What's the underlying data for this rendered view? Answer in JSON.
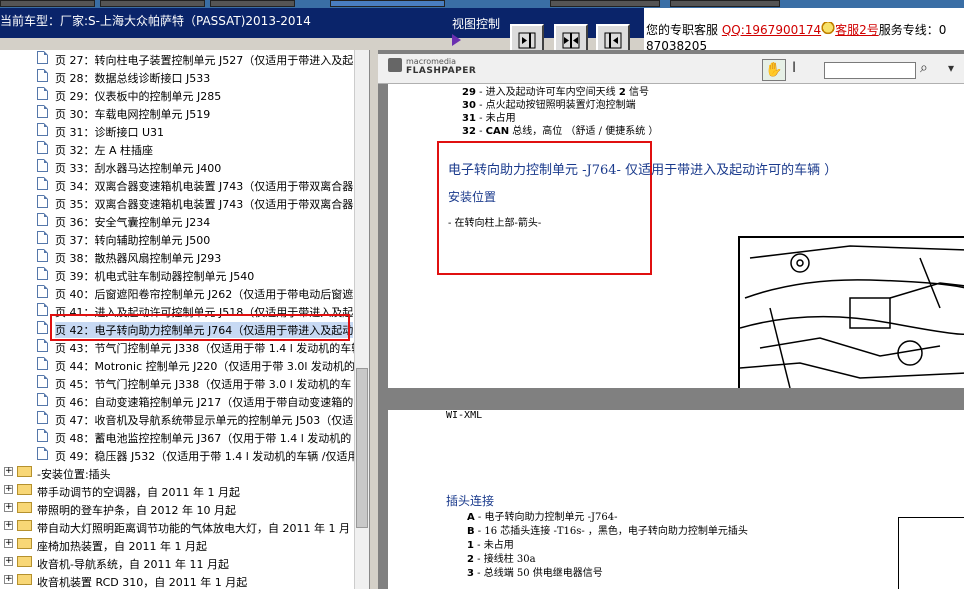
{
  "header": {
    "car_title": "当前车型：厂家:S-上海大众帕萨特（PASSAT)2013-2014",
    "view_control_label": "视图控制",
    "service_prefix": "您的专职客服",
    "qq": "QQ:1967900174",
    "kefu2": "客服2号",
    "hotline_label": "服务专线：0",
    "hotline_cont": "87038205"
  },
  "tree": {
    "pages": [
      {
        "text": "页 27：转向柱电子装置控制单元 J527（仅适用于带进入及起",
        "selected": false
      },
      {
        "text": "页 28：数据总线诊断接口 J533",
        "selected": false
      },
      {
        "text": "页 29：仪表板中的控制单元 J285",
        "selected": false
      },
      {
        "text": "页 30：车载电网控制单元 J519",
        "selected": false
      },
      {
        "text": "页 31：诊断接口 U31",
        "selected": false
      },
      {
        "text": "页 32：左 A 柱插座",
        "selected": false
      },
      {
        "text": "页 33：刮水器马达控制单元 J400",
        "selected": false
      },
      {
        "text": "页 34：双离合器变速箱机电装置 J743（仅适用于带双离合器",
        "selected": false
      },
      {
        "text": "页 35：双离合器变速箱机电装置 J743（仅适用于带双离合器",
        "selected": false
      },
      {
        "text": "页 36：安全气囊控制单元 J234",
        "selected": false
      },
      {
        "text": "页 37：转向辅助控制单元 J500",
        "selected": false
      },
      {
        "text": "页 38：散热器风扇控制单元 J293",
        "selected": false
      },
      {
        "text": "页 39：机电式驻车制动器控制单元 J540",
        "selected": false
      },
      {
        "text": "页 40：后窗遮阳卷帘控制单元 J262（仅适用于带电动后窗遮",
        "selected": false
      },
      {
        "text": "页 41：进入及起动许可控制单元 J518（仅适用于带进入及起",
        "selected": false
      },
      {
        "text": "页 42：电子转向助力控制单元 J764（仅适用于带进入及起动",
        "selected": true
      },
      {
        "text": "页 43：节气门控制单元 J338（仅适用于带 1.4 l 发动机的车辆",
        "selected": false
      },
      {
        "text": "页 44：Motronic 控制单元 J220（仅适用于带 3.0l 发动机的",
        "selected": false
      },
      {
        "text": "页 45：节气门控制单元 J338（仅适用于带 3.0 l 发动机的车",
        "selected": false
      },
      {
        "text": "页 46：自动变速箱控制单元 J217（仅适用于带自动变速箱的",
        "selected": false
      },
      {
        "text": "页 47：收音机及导航系统带显示单元的控制单元 J503（仅适",
        "selected": false
      },
      {
        "text": "页 48：蓄电池监控控制单元 J367（仅用于带 1.4 l 发动机的",
        "selected": false
      },
      {
        "text": "页 49：稳压器 J532（仅适用于带 1.4 l 发动机的车辆 /仅适用",
        "selected": false
      }
    ],
    "folders": [
      "-安装位置:插头",
      "带手动调节的空调器，自 2011 年 1 月起",
      "带照明的登车护条，自 2012 年 10 月起",
      "带自动大灯照明距离调节功能的气体放电大灯，自 2011 年 1 月",
      "座椅加热装置，自 2011 年 1 月起",
      "收音机-导航系统，自 2011 年 11 月起",
      "收音机装置 RCD 310，自 2011 年 1 月起"
    ]
  },
  "viewer": {
    "macromedia": "macromedia",
    "flashpaper": "FLASHPAPER",
    "hand_icon": "hand-tool-icon",
    "page1": {
      "pins": [
        {
          "num": "29",
          "text": " - 进入及起动许可车内空间天线 ",
          "extra": "2",
          "suffix": " 信号"
        },
        {
          "num": "30",
          "text": " - 点火起动按钮照明装置灯泡控制端",
          "extra": "",
          "suffix": ""
        },
        {
          "num": "31",
          "text": " - 未占用",
          "extra": "",
          "suffix": ""
        },
        {
          "num": "32",
          "text": " - ",
          "extra": "CAN",
          "suffix": " 总线，高位 （舒适 / 便捷系统 ）"
        }
      ],
      "title": "电子转向助力控制单元  -J764-  仅适用于带进入及起动许可的车辆 ）",
      "subtitle": "安装位置",
      "desc": "- 在转向柱上部-箭头-"
    },
    "page2": {
      "wi": "WI-XML",
      "section": "插头连接",
      "lines": [
        {
          "key": "A",
          "text": " - 电子转向助力控制单元  -J764-"
        },
        {
          "key": "B",
          "text": " - 16 芯插头连接  -T16s- ，黑色，电子转向助力控制单元插头"
        },
        {
          "key": "1",
          "text": " - 未占用"
        },
        {
          "key": "2",
          "text": " - 接线柱  30a"
        },
        {
          "key": "3",
          "text": " - 总线端  50 供电继电器信号"
        }
      ]
    }
  },
  "colors": {
    "accent_red": "#e01010",
    "title_blue": "#1a3a8c",
    "header_bg": "#0a246a"
  }
}
